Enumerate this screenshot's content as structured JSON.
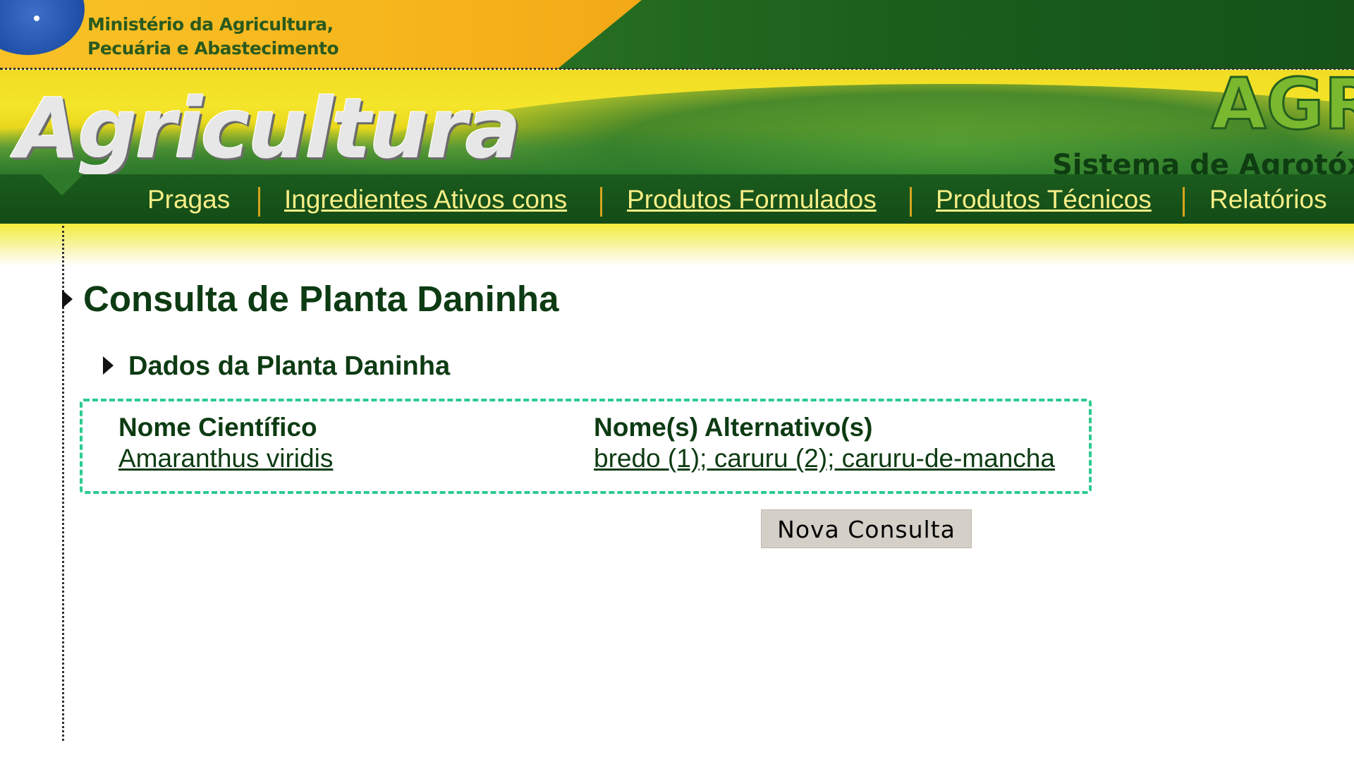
{
  "header": {
    "ministry_line1": "Ministério da Agricultura,",
    "ministry_line2": "Pecuária e Abastecimento",
    "brand": "Agricultura",
    "system_logo": "AGR",
    "system_name": "Sistema de Agrotóx",
    "colors": {
      "brand_green": "#144b17",
      "brand_yellow": "#f4e52a",
      "nav_text": "#f7ee87"
    }
  },
  "nav": {
    "items": [
      {
        "label": "Pragas"
      },
      {
        "label": "Ingredientes Ativos cons"
      },
      {
        "label": "Produtos Formulados"
      },
      {
        "label": "Produtos Técnicos"
      },
      {
        "label": "Relatórios"
      }
    ]
  },
  "main": {
    "page_title": "Consulta de Planta Daninha",
    "section_title": "Dados da Planta Daninha",
    "table": {
      "headers": [
        "Nome Científico",
        "Nome(s) Alternativo(s)"
      ],
      "row": [
        "Amaranthus viridis",
        "bredo (1); caruru (2); caruru-de-mancha"
      ]
    },
    "new_query_button": "Nova Consulta",
    "highlight_color": "#2ccb8f"
  }
}
